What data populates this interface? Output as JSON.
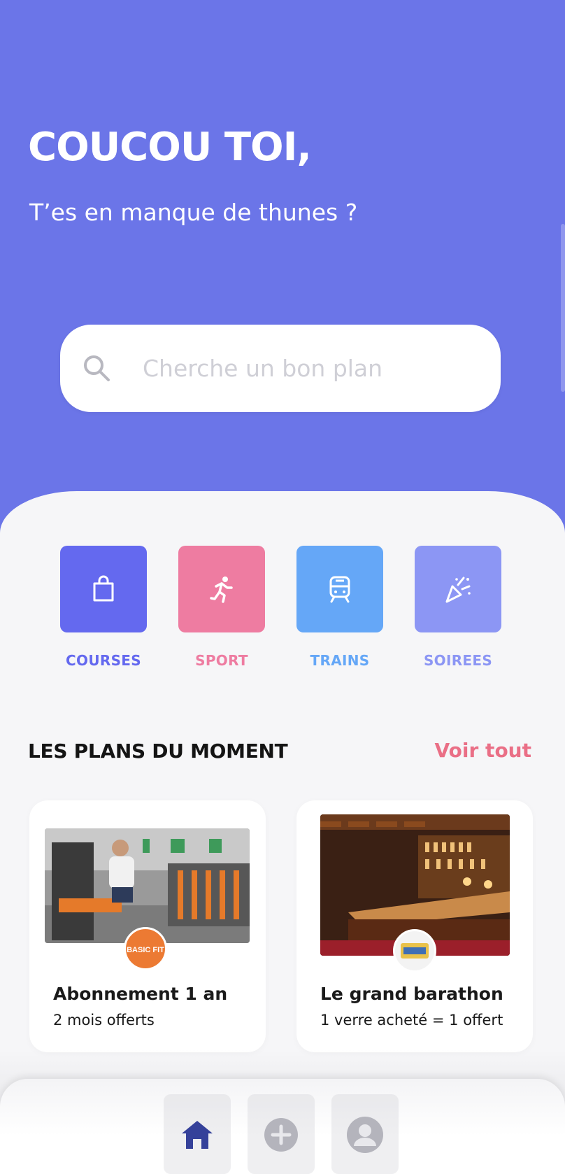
{
  "header": {
    "greeting": "COUCOU TOI,",
    "subtitle": "T’es en manque de thunes ?"
  },
  "search": {
    "placeholder": "Cherche un bon plan",
    "icon": "search-icon"
  },
  "categories": [
    {
      "label": "COURSES",
      "icon": "shopping-bag-icon",
      "color": "#6469ef"
    },
    {
      "label": "SPORT",
      "icon": "running-icon",
      "color": "#ee7ca1"
    },
    {
      "label": "TRAINS",
      "icon": "train-icon",
      "color": "#65a7f7"
    },
    {
      "label": "SOIREES",
      "icon": "party-popper-icon",
      "color": "#8c96f4"
    }
  ],
  "section": {
    "title": "LES PLANS DU MOMENT",
    "see_all": "Voir tout"
  },
  "deals": [
    {
      "title": "Abonnement 1 an",
      "subtitle": "2 mois offerts",
      "logo_text": "BASIC FIT"
    },
    {
      "title": "Le grand barathon",
      "subtitle": "1 verre acheté = 1 offert"
    }
  ],
  "tabbar": [
    {
      "icon": "home-icon",
      "active": true
    },
    {
      "icon": "add-circle-icon",
      "active": false
    },
    {
      "icon": "profile-icon",
      "active": false
    }
  ],
  "colors": {
    "primary": "#6b75e8",
    "accent": "#ea6f86",
    "background": "#f6f6f8"
  }
}
